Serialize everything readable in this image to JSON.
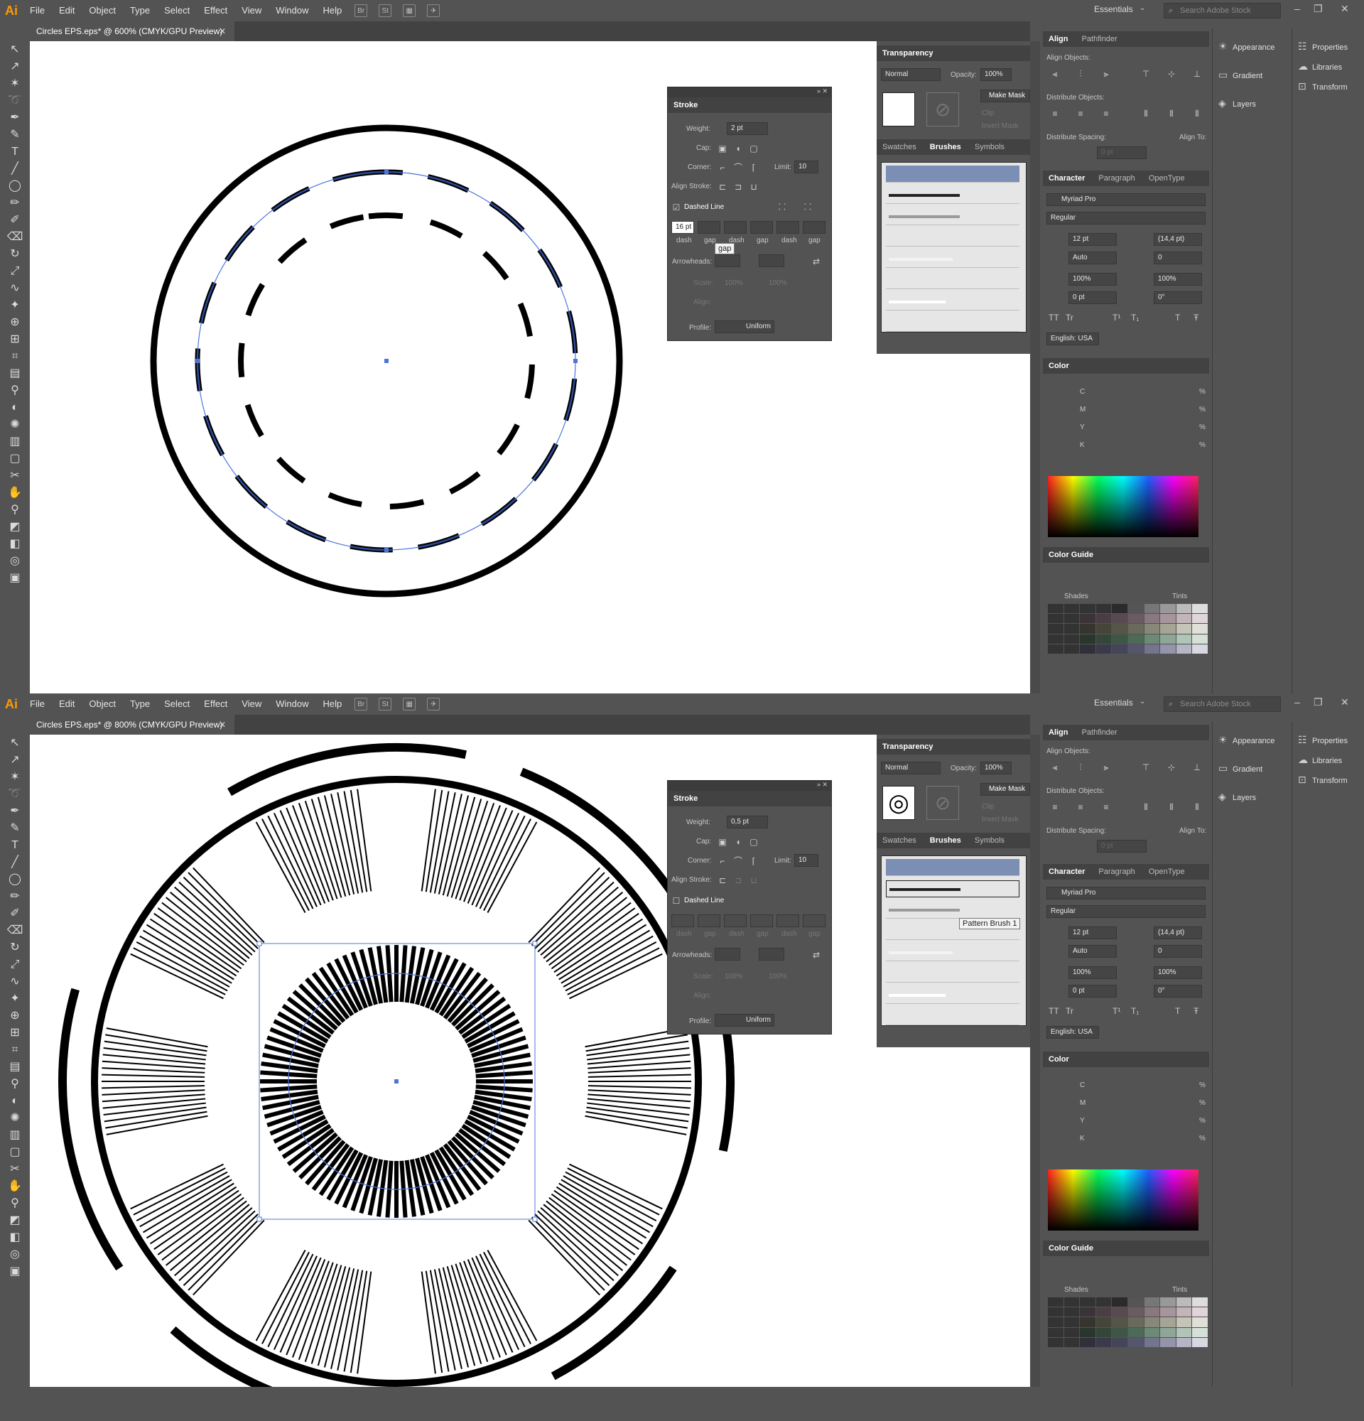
{
  "menubar": {
    "logo": "Ai",
    "items": [
      "File",
      "Edit",
      "Object",
      "Type",
      "Select",
      "Effect",
      "View",
      "Window",
      "Help"
    ],
    "bridge_label": "Br",
    "stock_label": "St",
    "workspace": "Essentials",
    "search_placeholder": "Search Adobe Stock"
  },
  "screens": [
    {
      "doc_tab": "Circles EPS.eps* @ 600% (CMYK/GPU Preview)",
      "stroke": {
        "title": "Stroke",
        "weight_label": "Weight:",
        "weight": "2 pt",
        "cap_label": "Cap:",
        "corner_label": "Corner:",
        "limit_label": "Limit:",
        "limit": "10",
        "align_label": "Align Stroke:",
        "dashed_label": "Dashed Line",
        "dashed_checked": true,
        "dash_value": "16 pt",
        "dash_labels": [
          "dash",
          "gap",
          "dash",
          "gap",
          "dash",
          "gap"
        ],
        "tooltip": "gap",
        "arrowheads_label": "Arrowheads:",
        "scale_label": "Scale:",
        "scale_values": [
          "100%",
          "100%"
        ],
        "align2_label": "Align:",
        "profile_label": "Profile:",
        "profile_value": "Uniform"
      },
      "brushes_tooltip": ""
    },
    {
      "doc_tab": "Circles EPS.eps* @ 800% (CMYK/GPU Preview)",
      "stroke": {
        "title": "Stroke",
        "weight_label": "Weight:",
        "weight": "0,5 pt",
        "cap_label": "Cap:",
        "corner_label": "Corner:",
        "limit_label": "Limit:",
        "limit": "10",
        "align_label": "Align Stroke:",
        "dashed_label": "Dashed Line",
        "dashed_checked": false,
        "dash_value": "",
        "dash_labels": [
          "dash",
          "gap",
          "dash",
          "gap",
          "dash",
          "gap"
        ],
        "tooltip": "",
        "arrowheads_label": "Arrowheads:",
        "scale_label": "Scale:",
        "scale_values": [
          "100%",
          "100%"
        ],
        "align2_label": "Align:",
        "profile_label": "Profile:",
        "profile_value": "Uniform"
      },
      "brushes_tooltip": "Pattern Brush 1"
    }
  ],
  "transparency": {
    "title": "Transparency",
    "mode": "Normal",
    "opacity_label": "Opacity:",
    "opacity": "100%",
    "make_mask": "Make Mask",
    "clip": "Clip",
    "invert_mask": "Invert Mask"
  },
  "brushes_tabs": [
    "Swatches",
    "Brushes",
    "Symbols"
  ],
  "align": {
    "tabs": [
      "Align",
      "Pathfinder"
    ],
    "objects_label": "Align Objects:",
    "distribute_label": "Distribute Objects:",
    "spacing_label": "Distribute Spacing:",
    "align_to_label": "Align To:",
    "spacing_value": "0 pt"
  },
  "character": {
    "tabs": [
      "Character",
      "Paragraph",
      "OpenType"
    ],
    "font": "Myriad Pro",
    "style": "Regular",
    "size": "12 pt",
    "leading": "(14,4 pt)",
    "kerning": "Auto",
    "tracking": "0",
    "vscale": "100%",
    "hscale": "100%",
    "baseline": "0 pt",
    "rotation": "0°",
    "language": "English: USA",
    "type_buttons": [
      "TT",
      "Tr",
      "T¹",
      "T₁",
      "T",
      "Ŧ"
    ]
  },
  "color": {
    "title": "Color",
    "channels": [
      "C",
      "M",
      "Y",
      "K"
    ],
    "unit": "%"
  },
  "color_guide": {
    "title": "Color Guide",
    "shades": "Shades",
    "tints": "Tints"
  },
  "side_panel": {
    "items": [
      "Appearance",
      "Gradient",
      "Layers"
    ],
    "items2": [
      "Properties",
      "Libraries",
      "Transform"
    ]
  },
  "accent": "#4d75d9",
  "app_bg": "#535353"
}
